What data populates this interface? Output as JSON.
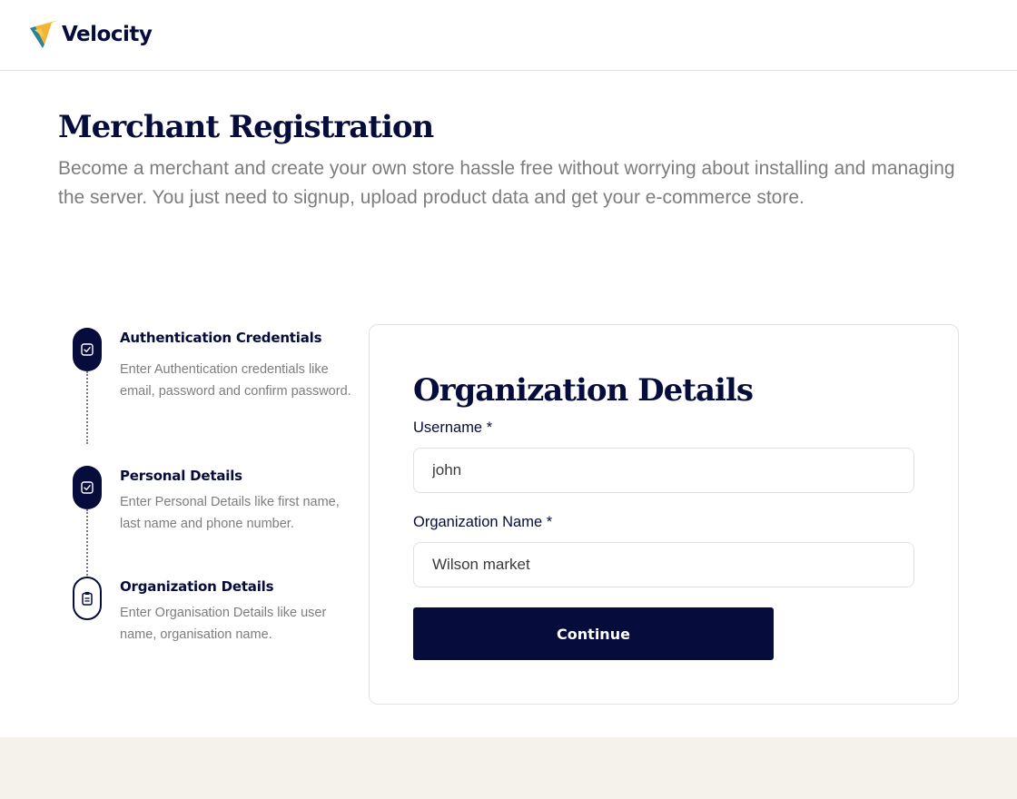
{
  "brand": {
    "name": "Velocity",
    "colors": {
      "navy": "#060c3b",
      "logo_yellow": "#f3b530",
      "logo_teal": "#2f8296"
    }
  },
  "hero": {
    "title": "Merchant Registration",
    "description": "Become a merchant and create your own store hassle free without worrying about installing and managing the server. You just need to signup, upload product data and get your e-commerce store."
  },
  "steps": [
    {
      "title": "Authentication Credentials",
      "description": "Enter Authentication credentials like email, password and confirm password.",
      "status": "completed",
      "icon": "check-square-icon"
    },
    {
      "title": "Personal Details",
      "description": "Enter Personal Details like first name, last name and phone number.",
      "status": "completed",
      "icon": "check-square-icon"
    },
    {
      "title": "Organization Details",
      "description": "Enter Organisation Details like user name, organisation name.",
      "status": "current",
      "icon": "clipboard-icon"
    }
  ],
  "form": {
    "title": "Organization Details",
    "username": {
      "label": "Username *",
      "value": "john"
    },
    "organization_name": {
      "label": "Organization Name *",
      "value": "Wilson market"
    },
    "continue_label": "Continue"
  }
}
